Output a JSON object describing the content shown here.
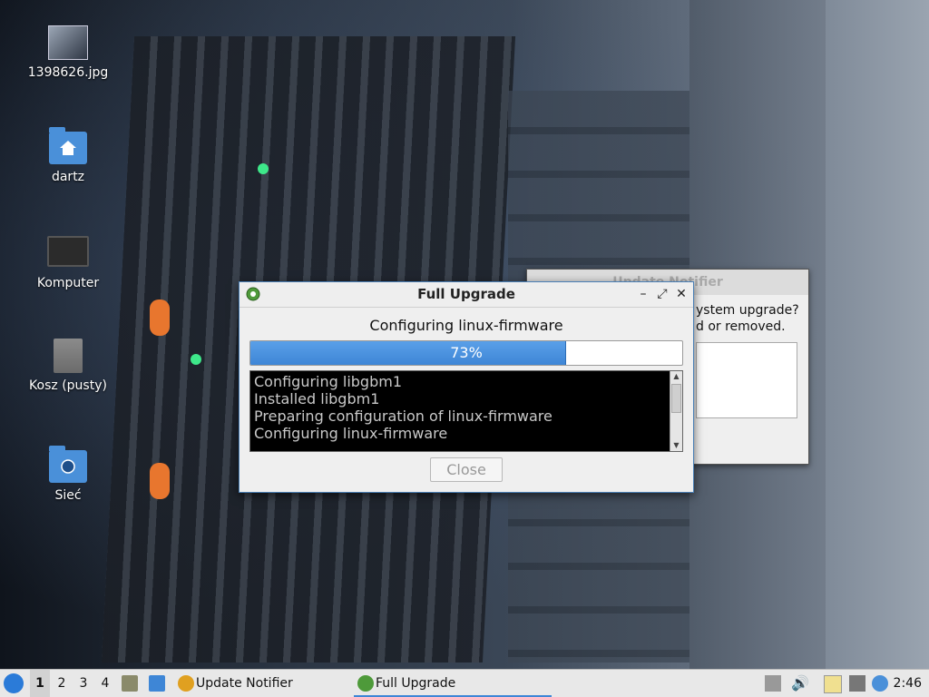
{
  "desktop": {
    "icons": [
      {
        "label": "1398626.jpg",
        "icon": "image-file-icon"
      },
      {
        "label": "dartz",
        "icon": "home-folder-icon"
      },
      {
        "label": "Komputer",
        "icon": "computer-icon"
      },
      {
        "label": "Kosz (pusty)",
        "icon": "trash-icon"
      },
      {
        "label": "Sieć",
        "icon": "network-folder-icon"
      }
    ]
  },
  "background_window": {
    "title": "Update Notifier",
    "text_line1": "ystem upgrade?",
    "text_line2": "d or removed."
  },
  "dialog": {
    "title": "Full Upgrade",
    "status": "Configuring linux-firmware",
    "progress_percent": 73,
    "progress_label": "73%",
    "log_lines": [
      "Configuring libgbm1",
      "Installed libgbm1",
      "Preparing configuration of linux-firmware",
      "Configuring linux-firmware"
    ],
    "close_label": "Close"
  },
  "taskbar": {
    "workspaces": [
      "1",
      "2",
      "3",
      "4"
    ],
    "active_workspace": "1",
    "tasks": [
      {
        "label": "Update Notifier",
        "icon": "update-notifier-icon"
      },
      {
        "label": "Full Upgrade",
        "icon": "gear-icon"
      }
    ],
    "clock": "2:46"
  },
  "colors": {
    "accent": "#3e86d6",
    "dialog_bg": "#efefef",
    "log_bg": "#000000"
  }
}
